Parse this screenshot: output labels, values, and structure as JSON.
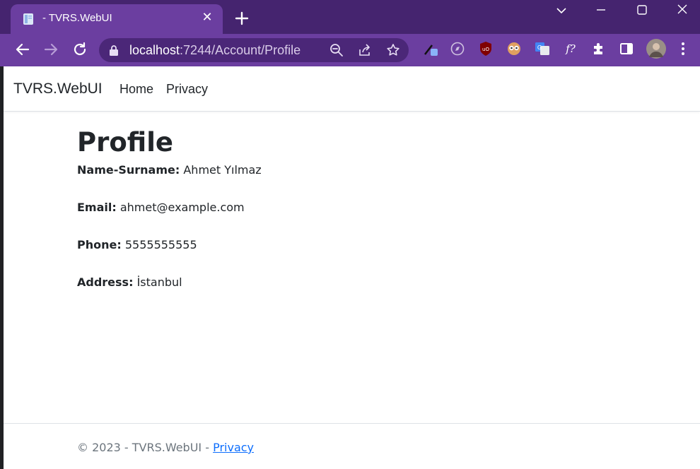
{
  "browser": {
    "tab_title": "- TVRS.WebUI",
    "url_host": "localhost",
    "url_path": ":7244/Account/Profile"
  },
  "navbar": {
    "brand": "TVRS.WebUI",
    "links": [
      "Home",
      "Privacy"
    ]
  },
  "profile": {
    "heading": "Profile",
    "fields": [
      {
        "label": "Name-Surname:",
        "value": "Ahmet Yılmaz"
      },
      {
        "label": "Email:",
        "value": "ahmet@example.com"
      },
      {
        "label": "Phone:",
        "value": "5555555555"
      },
      {
        "label": "Address:",
        "value": "İstanbul"
      }
    ]
  },
  "footer": {
    "text": "© 2023 - TVRS.WebUI - ",
    "link": "Privacy"
  },
  "colors": {
    "chrome_titlebar": "#45246f",
    "chrome_toolbar": "#6b3ea0",
    "link_blue": "#0d6efd",
    "text_dark": "#212529",
    "footer_gray": "#6c757d"
  }
}
